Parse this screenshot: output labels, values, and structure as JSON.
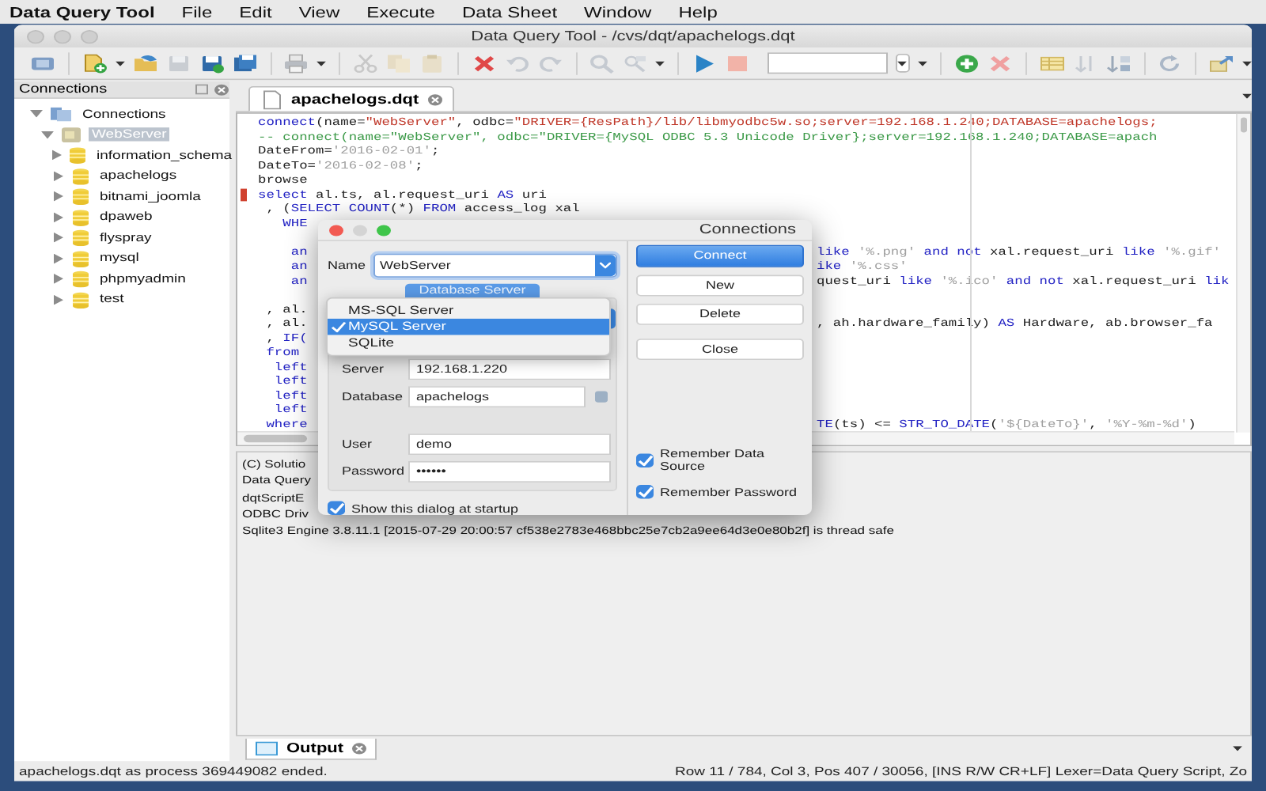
{
  "menubar": {
    "app_name": "Data Query Tool",
    "items": [
      "File",
      "Edit",
      "View",
      "Execute",
      "Data Sheet",
      "Window",
      "Help"
    ]
  },
  "window": {
    "title": "Data Query Tool - /cvs/dqt/apachelogs.dqt"
  },
  "connections_panel": {
    "title": "Connections",
    "tree": [
      {
        "label": "Connections",
        "expanded": true,
        "selected": false,
        "children": [
          {
            "label": "WebServer",
            "expanded": true,
            "selected": true,
            "children": [
              {
                "label": "information_schema",
                "expanded": false,
                "selected": false
              },
              {
                "label": "apachelogs",
                "expanded": false,
                "selected": false
              },
              {
                "label": "bitnami_joomla",
                "expanded": false,
                "selected": false
              },
              {
                "label": "dpaweb",
                "expanded": false,
                "selected": false
              },
              {
                "label": "flyspray",
                "expanded": false,
                "selected": false
              },
              {
                "label": "mysql",
                "expanded": false,
                "selected": false
              },
              {
                "label": "phpmyadmin",
                "expanded": false,
                "selected": false
              },
              {
                "label": "test",
                "expanded": false,
                "selected": false
              }
            ]
          }
        ]
      }
    ]
  },
  "editor": {
    "tabs": [
      {
        "label": "apachelogs.dqt",
        "selected": true
      }
    ],
    "lines": [
      {
        "bookmarked": false,
        "left": [
          {
            "kind": "keyword",
            "text": "connect"
          },
          {
            "kind": "plain",
            "text": "(name="
          },
          {
            "kind": "string",
            "text": "\"WebServer\""
          },
          {
            "kind": "plain",
            "text": ", odbc="
          },
          {
            "kind": "string",
            "text": "\"DRIVER={ResPath}/lib/libmyodbc5w.so;server=192.168.1.240;DATABASE=apachelogs;"
          }
        ]
      },
      {
        "bookmarked": false,
        "left": [
          {
            "kind": "comment",
            "text": "-- connect(name=\"WebServer\", odbc=\"DRIVER={MySQL ODBC 5.3 Unicode Driver};server=192.168.1.240;DATABASE=apach"
          }
        ]
      },
      {
        "bookmarked": false,
        "left": [
          {
            "kind": "plain",
            "text": "DateFrom="
          },
          {
            "kind": "literal",
            "text": "'2016-02-01'"
          },
          {
            "kind": "plain",
            "text": ";"
          }
        ]
      },
      {
        "bookmarked": false,
        "left": [
          {
            "kind": "plain",
            "text": "DateTo="
          },
          {
            "kind": "literal",
            "text": "'2016-02-08'"
          },
          {
            "kind": "plain",
            "text": ";"
          }
        ]
      },
      {
        "bookmarked": false,
        "left": [
          {
            "kind": "plain",
            "text": "browse"
          }
        ]
      },
      {
        "bookmarked": true,
        "left": [
          {
            "kind": "keyword",
            "text": "select"
          },
          {
            "kind": "plain",
            "text": " al.ts, al.request_uri "
          },
          {
            "kind": "keyword",
            "text": "AS"
          },
          {
            "kind": "plain",
            "text": " uri"
          }
        ]
      },
      {
        "bookmarked": false,
        "left": [
          {
            "kind": "plain",
            "text": " , ("
          },
          {
            "kind": "keyword",
            "text": "SELECT COUNT"
          },
          {
            "kind": "plain",
            "text": "(*) "
          },
          {
            "kind": "keyword",
            "text": "FROM"
          },
          {
            "kind": "plain",
            "text": " access_log xal"
          }
        ]
      },
      {
        "bookmarked": false,
        "left": [
          {
            "kind": "keyword",
            "text": "   WHE"
          }
        ]
      },
      {
        "bookmarked": false,
        "gap_before": true,
        "left": [
          {
            "kind": "keyword",
            "text": "    an"
          }
        ],
        "right": [
          {
            "kind": "keyword",
            "text": "like"
          },
          {
            "kind": "literal",
            "text": " '%.png'"
          },
          {
            "kind": "keyword",
            "text": " and not"
          },
          {
            "kind": "plain",
            "text": " xal.request_uri "
          },
          {
            "kind": "keyword",
            "text": "like"
          },
          {
            "kind": "literal",
            "text": " '%.gif'"
          }
        ]
      },
      {
        "bookmarked": false,
        "left": [
          {
            "kind": "keyword",
            "text": "    an"
          }
        ],
        "right": [
          {
            "kind": "keyword",
            "text": "ike"
          },
          {
            "kind": "literal",
            "text": " '%.css'"
          }
        ]
      },
      {
        "bookmarked": false,
        "left": [
          {
            "kind": "keyword",
            "text": "    an"
          }
        ],
        "right": [
          {
            "kind": "plain",
            "text": "quest_uri "
          },
          {
            "kind": "keyword",
            "text": "like"
          },
          {
            "kind": "literal",
            "text": " '%.ico'"
          },
          {
            "kind": "keyword",
            "text": " and not"
          },
          {
            "kind": "plain",
            "text": " xal.request_uri "
          },
          {
            "kind": "keyword",
            "text": "lik"
          }
        ]
      },
      {
        "bookmarked": false,
        "gap_before": true,
        "left": [
          {
            "kind": "plain",
            "text": " , al."
          }
        ]
      },
      {
        "bookmarked": false,
        "left": [
          {
            "kind": "plain",
            "text": " , al."
          }
        ],
        "right": [
          {
            "kind": "plain",
            "text": ", ah.hardware_family) "
          },
          {
            "kind": "keyword",
            "text": "AS"
          },
          {
            "kind": "plain",
            "text": " Hardware, ab.browser_fa"
          }
        ]
      },
      {
        "bookmarked": false,
        "left": [
          {
            "kind": "plain",
            "text": " , "
          },
          {
            "kind": "keyword",
            "text": "IF("
          }
        ]
      },
      {
        "bookmarked": false,
        "left": [
          {
            "kind": "keyword",
            "text": " from"
          }
        ]
      },
      {
        "bookmarked": false,
        "left": [
          {
            "kind": "keyword",
            "text": "  left"
          }
        ]
      },
      {
        "bookmarked": false,
        "left": [
          {
            "kind": "keyword",
            "text": "  left"
          }
        ]
      },
      {
        "bookmarked": false,
        "left": [
          {
            "kind": "keyword",
            "text": "  left"
          }
        ]
      },
      {
        "bookmarked": false,
        "left": [
          {
            "kind": "keyword",
            "text": "  left"
          }
        ]
      },
      {
        "bookmarked": false,
        "left": [
          {
            "kind": "keyword",
            "text": " where"
          }
        ],
        "right": [
          {
            "kind": "keyword",
            "text": "TE"
          },
          {
            "kind": "plain",
            "text": "(ts) <= "
          },
          {
            "kind": "keyword",
            "text": "STR_TO_DATE"
          },
          {
            "kind": "plain",
            "text": "("
          },
          {
            "kind": "literal",
            "text": "'${DateTo}'"
          },
          {
            "kind": "plain",
            "text": ", "
          },
          {
            "kind": "literal",
            "text": "'%Y-%m-%d'"
          },
          {
            "kind": "plain",
            "text": ")"
          }
        ]
      }
    ]
  },
  "output": {
    "lines": [
      "(C) Solutio",
      "Data Query",
      "dqtScriptE",
      "ODBC Driv",
      "Sqlite3 Engine 3.8.11.1 [2015-07-29 20:00:57 cf538e2783e468bbc25e7cb2a9ee64d3e0e80b2f] is thread safe"
    ],
    "tabs": [
      {
        "label": "Output",
        "selected": true
      }
    ]
  },
  "status_bar": {
    "left": "apachelogs.dqt as process 369449082 ended.",
    "right": "Row 11 / 784, Col 3, Pos 407 / 30056, [INS R/W CR+LF] Lexer=Data Query Script, Zo"
  },
  "dialog": {
    "title": "Connections",
    "name_label": "Name",
    "name_value": "WebServer",
    "section_button": "Database Server",
    "type_menu": [
      {
        "label": "MS-SQL Server",
        "selected": false
      },
      {
        "label": "MySQL Server",
        "selected": true
      },
      {
        "label": "SQLite",
        "selected": false
      }
    ],
    "fields": [
      {
        "label": "Server",
        "value": "192.168.1.220"
      },
      {
        "label": "Database",
        "value": "apachelogs"
      },
      {
        "label": "User",
        "value": "demo"
      },
      {
        "label": "Password",
        "value": "••••••"
      }
    ],
    "show_at_startup": {
      "label": "Show this dialog at startup",
      "checked": true
    },
    "buttons": [
      {
        "label": "Connect",
        "primary": true
      },
      {
        "label": "New",
        "primary": false
      },
      {
        "label": "Delete",
        "primary": false
      },
      {
        "label": "Close",
        "primary": false
      }
    ],
    "options": [
      {
        "label": "Remember Data Source",
        "checked": true
      },
      {
        "label": "Remember Password",
        "checked": true
      }
    ]
  }
}
